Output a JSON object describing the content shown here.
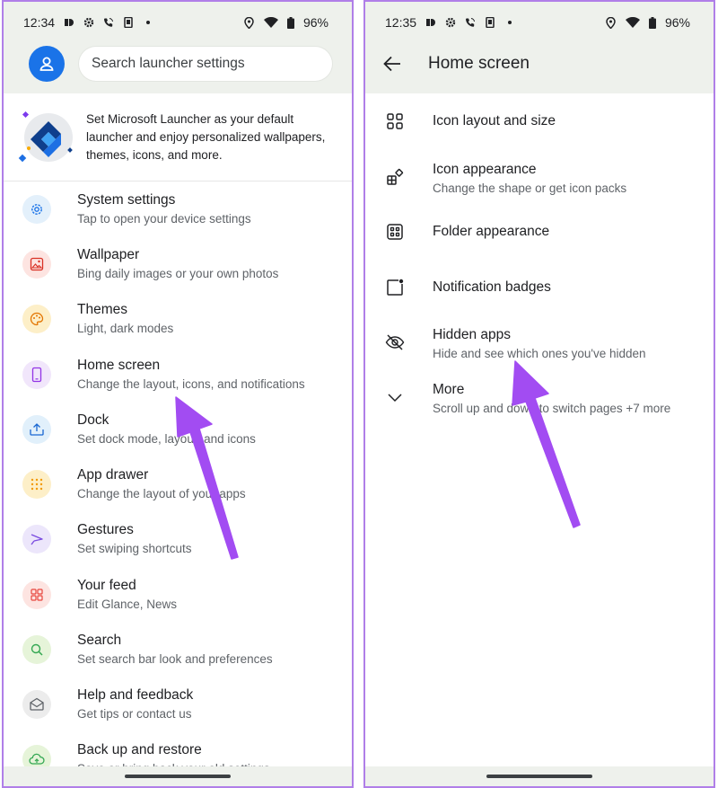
{
  "left": {
    "status": {
      "time": "12:34",
      "battery": "96%"
    },
    "search": {
      "placeholder": "Search launcher settings"
    },
    "promo": {
      "text": "Set Microsoft Launcher as your default launcher and enjoy personalized wallpapers, themes, icons, and more."
    },
    "items": [
      {
        "title": "System settings",
        "subtitle": "Tap to open your device settings",
        "icon": "gear-icon",
        "bg": "#e3f0fb",
        "fg": "#1a73e8"
      },
      {
        "title": "Wallpaper",
        "subtitle": "Bing daily images or your own photos",
        "icon": "image-icon",
        "bg": "#fde4e1",
        "fg": "#d93025"
      },
      {
        "title": "Themes",
        "subtitle": "Light, dark modes",
        "icon": "palette-icon",
        "bg": "#fdefc8",
        "fg": "#e37400"
      },
      {
        "title": "Home screen",
        "subtitle": "Change the layout, icons, and notifications",
        "icon": "phone-icon",
        "bg": "#f1e6fb",
        "fg": "#9334e6"
      },
      {
        "title": "Dock",
        "subtitle": "Set dock mode, layout, and icons",
        "icon": "dock-icon",
        "bg": "#e1f0fb",
        "fg": "#1967d2"
      },
      {
        "title": "App drawer",
        "subtitle": "Change the layout of your apps",
        "icon": "grid-dots-icon",
        "bg": "#fdefc8",
        "fg": "#f29900"
      },
      {
        "title": "Gestures",
        "subtitle": "Set swiping shortcuts",
        "icon": "gesture-icon",
        "bg": "#ece6fb",
        "fg": "#7b4de0"
      },
      {
        "title": "Your feed",
        "subtitle": "Edit Glance, News",
        "icon": "feed-icon",
        "bg": "#fde4e1",
        "fg": "#e8453c"
      },
      {
        "title": "Search",
        "subtitle": "Set search bar look and preferences",
        "icon": "search-icon",
        "bg": "#e6f4d9",
        "fg": "#34a853"
      },
      {
        "title": "Help and feedback",
        "subtitle": "Get tips or contact us",
        "icon": "help-mail-icon",
        "bg": "#ececec",
        "fg": "#5f6368"
      },
      {
        "title": "Back up and restore",
        "subtitle": "Save or bring back your old settings",
        "icon": "cloud-icon",
        "bg": "#e6f4d9",
        "fg": "#34a853"
      }
    ]
  },
  "right": {
    "status": {
      "time": "12:35",
      "battery": "96%"
    },
    "title": "Home screen",
    "items": [
      {
        "title": "Icon layout and size",
        "subtitle": "",
        "icon": "icon-layout-icon"
      },
      {
        "title": "Icon appearance",
        "subtitle": "Change the shape or get icon packs",
        "icon": "icon-appearance-icon"
      },
      {
        "title": "Folder appearance",
        "subtitle": "",
        "icon": "folder-grid-icon"
      },
      {
        "title": "Notification badges",
        "subtitle": "",
        "icon": "badge-icon"
      },
      {
        "title": "Hidden apps",
        "subtitle": "Hide and see which ones you've hidden",
        "icon": "eye-off-icon"
      },
      {
        "title": "More",
        "subtitle": "Scroll up and down to switch pages +7 more",
        "icon": "chevron-down-icon"
      }
    ]
  },
  "colors": {
    "arrow": "#a24cf2",
    "header_bg": "#eef1ec",
    "accent": "#1a73e8",
    "frame": "#b07fe8"
  }
}
